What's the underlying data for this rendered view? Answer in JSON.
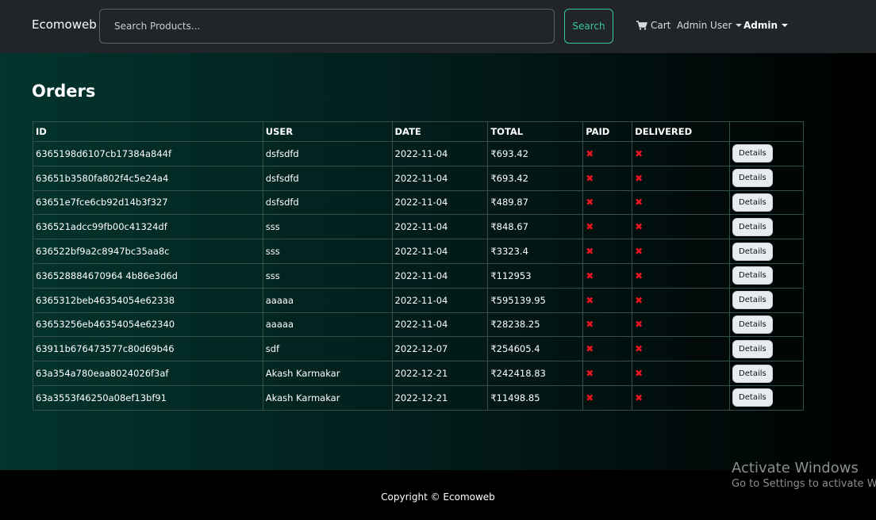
{
  "navbar": {
    "brand": "Ecomoweb",
    "search_placeholder": "Search Products...",
    "search_label": "Search",
    "cart_label": "Cart",
    "user_label": "Admin User",
    "admin_label": "Admin"
  },
  "page": {
    "title": "Orders"
  },
  "table": {
    "headers": [
      "ID",
      "USER",
      "DATE",
      "TOTAL",
      "PAID",
      "DELIVERED",
      ""
    ],
    "details_label": "Details",
    "rows": [
      {
        "id": "6365198d6107cb17384a844f",
        "user": "dsfsdfd",
        "date": "2022-11-04",
        "total": "₹693.42",
        "paid": "✖",
        "delivered": "✖"
      },
      {
        "id": "63651b3580fa802f4c5e24a4",
        "user": "dsfsdfd",
        "date": "2022-11-04",
        "total": "₹693.42",
        "paid": "✖",
        "delivered": "✖"
      },
      {
        "id": "63651e7fce6cb92d14b3f327",
        "user": "dsfsdfd",
        "date": "2022-11-04",
        "total": "₹489.87",
        "paid": "✖",
        "delivered": "✖"
      },
      {
        "id": "636521adcc99fb00c41324df",
        "user": "sss",
        "date": "2022-11-04",
        "total": "₹848.67",
        "paid": "✖",
        "delivered": "✖"
      },
      {
        "id": "636522bf9a2c8947bc35aa8c",
        "user": "sss",
        "date": "2022-11-04",
        "total": "₹3323.4",
        "paid": "✖",
        "delivered": "✖"
      },
      {
        "id": "636528884670964 4b86e3d6d",
        "user": "sss",
        "date": "2022-11-04",
        "total": "₹112953",
        "paid": "✖",
        "delivered": "✖"
      },
      {
        "id": "6365312beb46354054e62338",
        "user": "aaaaa",
        "date": "2022-11-04",
        "total": "₹595139.95",
        "paid": "✖",
        "delivered": "✖"
      },
      {
        "id": "63653256eb46354054e62340",
        "user": "aaaaa",
        "date": "2022-11-04",
        "total": "₹28238.25",
        "paid": "✖",
        "delivered": "✖"
      },
      {
        "id": "63911b676473577c80d69b46",
        "user": "sdf",
        "date": "2022-12-07",
        "total": "₹254605.4",
        "paid": "✖",
        "delivered": "✖"
      },
      {
        "id": "63a354a780eaa8024026f3af",
        "user": "Akash Karmakar",
        "date": "2022-12-21",
        "total": "₹242418.83",
        "paid": "✖",
        "delivered": "✖"
      },
      {
        "id": "63a3553f46250a08ef13bf91",
        "user": "Akash Karmakar",
        "date": "2022-12-21",
        "total": "₹11498.85",
        "paid": "✖",
        "delivered": "✖"
      }
    ]
  },
  "footer": {
    "copyright": "Copyright © Ecomoweb"
  },
  "watermark": {
    "title": "Activate Windows",
    "subtitle": "Go to Settings to activate Windows."
  },
  "icons": {
    "cart": "cart-icon",
    "caret": "chevron-down-icon",
    "x": "x-icon"
  },
  "colors": {
    "accent": "#3ac59a",
    "x_mark": "#e8141e",
    "navbar": "#212529"
  }
}
